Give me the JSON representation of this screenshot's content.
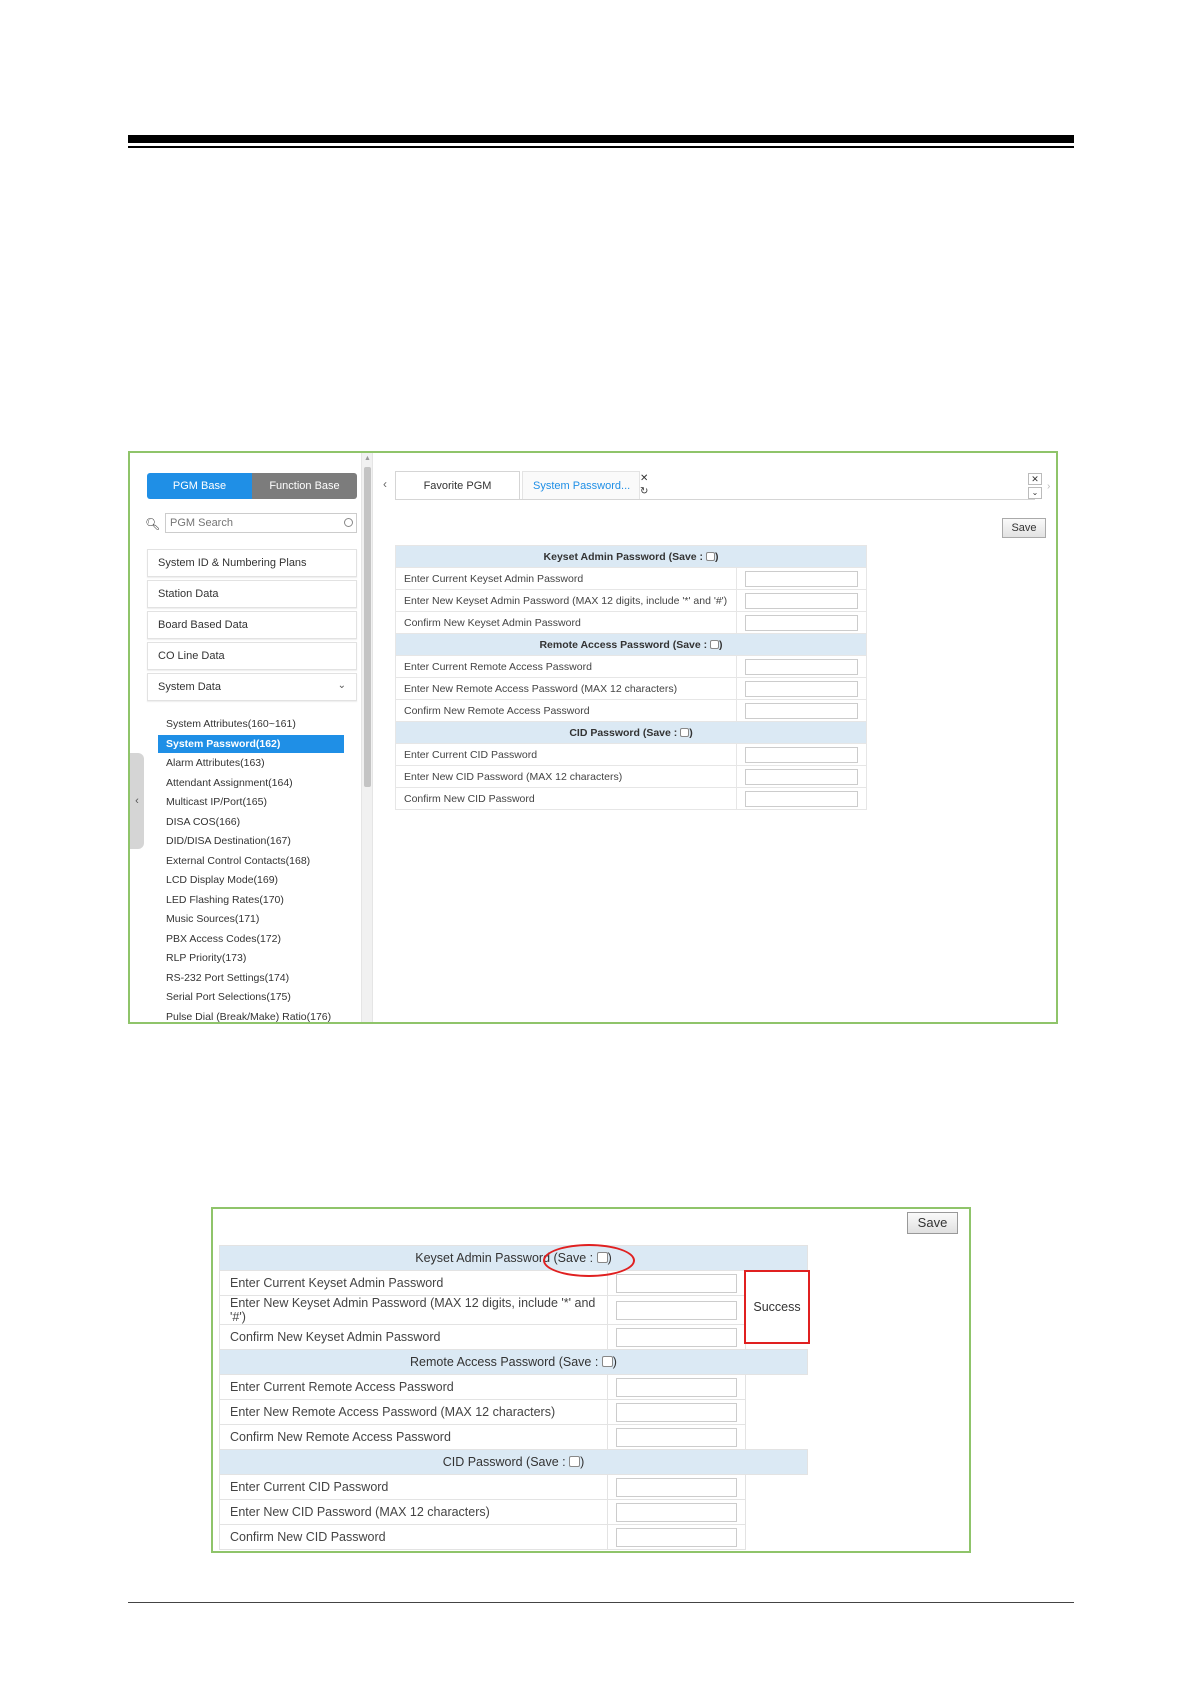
{
  "screenshot1": {
    "toggle": {
      "pgm_base": "PGM Base",
      "function_base": "Function Base"
    },
    "search": {
      "placeholder": "PGM Search"
    },
    "menu": [
      "System ID & Numbering Plans",
      "Station Data",
      "Board Based Data",
      "CO Line Data",
      "System Data"
    ],
    "submenu": [
      "System Attributes(160~161)",
      "System Password(162)",
      "Alarm Attributes(163)",
      "Attendant Assignment(164)",
      "Multicast IP/Port(165)",
      "DISA COS(166)",
      "DID/DISA Destination(167)",
      "External Control Contacts(168)",
      "LCD Display Mode(169)",
      "LED Flashing Rates(170)",
      "Music Sources(171)",
      "PBX Access Codes(172)",
      "RLP Priority(173)",
      "RS-232 Port Settings(174)",
      "Serial Port Selections(175)",
      "Pulse Dial (Break/Make) Ratio(176)"
    ],
    "active_submenu_index": 1,
    "tabs": {
      "favorite": "Favorite PGM",
      "system_password": "System Password..."
    },
    "save_label": "Save"
  },
  "sections": {
    "keyset": {
      "title": "Keyset Admin Password (Save : ",
      "title_end": ")",
      "rows": [
        "Enter Current Keyset Admin Password",
        "Enter New Keyset Admin Password (MAX 12 digits, include '*' and '#')",
        "Confirm New Keyset Admin Password"
      ]
    },
    "remote": {
      "title": "Remote Access Password (Save : ",
      "title_end": ")",
      "rows": [
        "Enter Current Remote Access Password",
        "Enter New Remote Access Password (MAX 12 characters)",
        "Confirm New Remote Access Password"
      ]
    },
    "cid": {
      "title": "CID Password (Save : ",
      "title_end": ")",
      "rows": [
        "Enter Current CID Password",
        "Enter New CID Password (MAX 12 characters)",
        "Confirm New CID Password"
      ]
    }
  },
  "screenshot2": {
    "save_label": "Save",
    "success_text": "Success"
  },
  "colors": {
    "accent_blue": "#1f8fe6",
    "frame_green": "#8fc46a",
    "header_blue": "#dbe9f4",
    "highlight_red": "#e02020"
  }
}
